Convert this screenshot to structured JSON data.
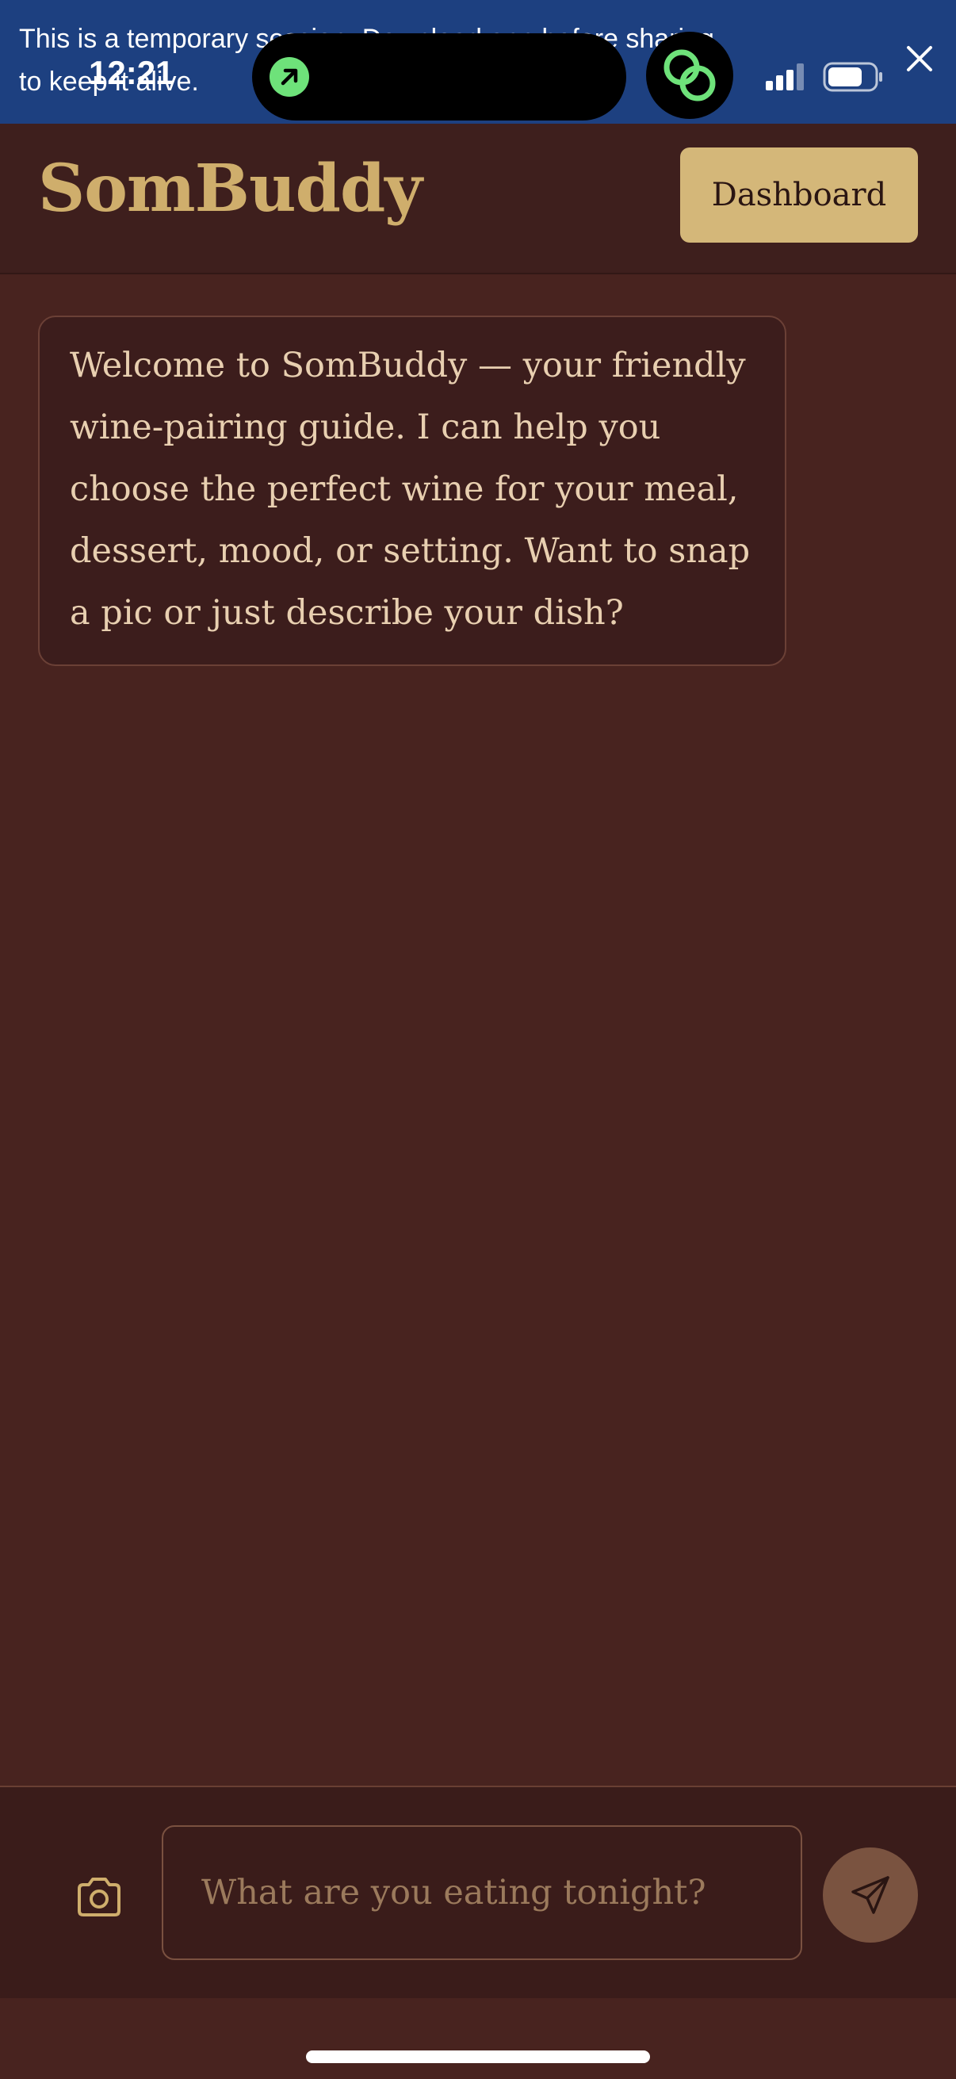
{
  "status_bar": {
    "time": "12:21",
    "banner_text": "This is a temporary session. Download app before sharing\nto keep it alive."
  },
  "header": {
    "brand": "SomBuddy",
    "dashboard_label": "Dashboard"
  },
  "chat": {
    "messages": [
      {
        "role": "assistant",
        "text": "Welcome to SomBuddy — your friendly wine-pairing guide. I can help you choose the perfect wine for your meal, dessert, mood, or setting. Want to snap a pic or just describe your dish?"
      }
    ]
  },
  "composer": {
    "placeholder": "What are you eating tonight?",
    "value": ""
  },
  "icons": {
    "close": "close-icon",
    "camera": "camera-icon",
    "send": "send-icon",
    "signal": "signal-icon",
    "battery": "battery-icon"
  },
  "colors": {
    "background": "#48231f",
    "header": "#3e1f1d",
    "brand": "#cfae6c",
    "button": "#d4b779",
    "banner": "#1d4080",
    "bubble_text": "#e8cfb0"
  }
}
